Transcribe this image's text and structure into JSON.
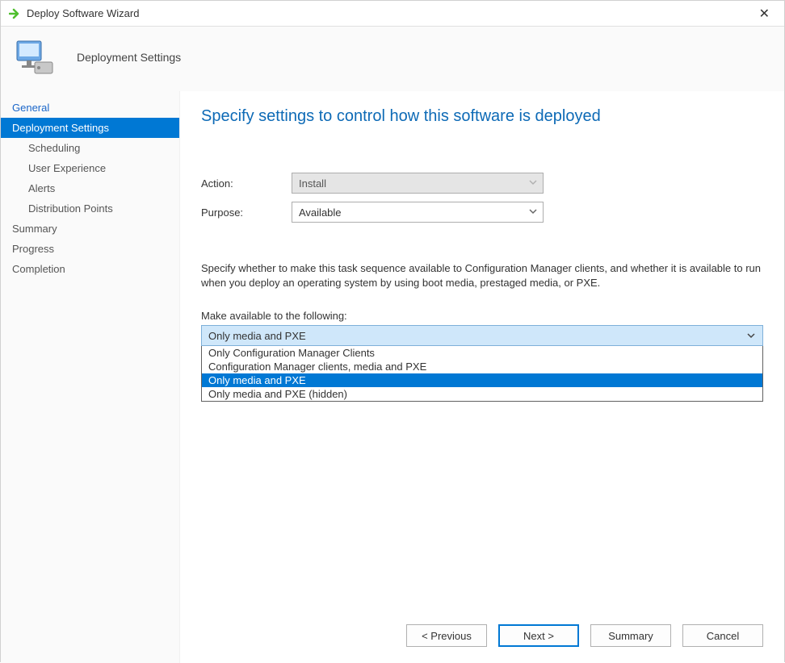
{
  "window": {
    "title": "Deploy Software Wizard",
    "close_symbol": "✕"
  },
  "header": {
    "title": "Deployment Settings"
  },
  "sidebar": {
    "items": [
      {
        "label": "General",
        "link": true,
        "indent": false,
        "selected": false
      },
      {
        "label": "Deployment Settings",
        "link": false,
        "indent": false,
        "selected": true
      },
      {
        "label": "Scheduling",
        "link": false,
        "indent": true,
        "selected": false
      },
      {
        "label": "User Experience",
        "link": false,
        "indent": true,
        "selected": false
      },
      {
        "label": "Alerts",
        "link": false,
        "indent": true,
        "selected": false
      },
      {
        "label": "Distribution Points",
        "link": false,
        "indent": true,
        "selected": false
      },
      {
        "label": "Summary",
        "link": false,
        "indent": false,
        "selected": false
      },
      {
        "label": "Progress",
        "link": false,
        "indent": false,
        "selected": false
      },
      {
        "label": "Completion",
        "link": false,
        "indent": false,
        "selected": false
      }
    ]
  },
  "content": {
    "heading": "Specify settings to control how this software is deployed",
    "action_label": "Action:",
    "action_value": "Install",
    "purpose_label": "Purpose:",
    "purpose_value": "Available",
    "description": "Specify whether to make this task sequence available to Configuration Manager clients, and whether it is available to run when you deploy an operating system by using boot media, prestaged media, or PXE.",
    "available_label": "Make available to the following:",
    "available_selected": "Only media and PXE",
    "available_options": [
      "Only Configuration Manager Clients",
      "Configuration Manager clients, media and PXE",
      "Only media and PXE",
      "Only media and PXE (hidden)"
    ]
  },
  "buttons": {
    "previous": "< Previous",
    "next": "Next >",
    "summary": "Summary",
    "cancel": "Cancel"
  }
}
